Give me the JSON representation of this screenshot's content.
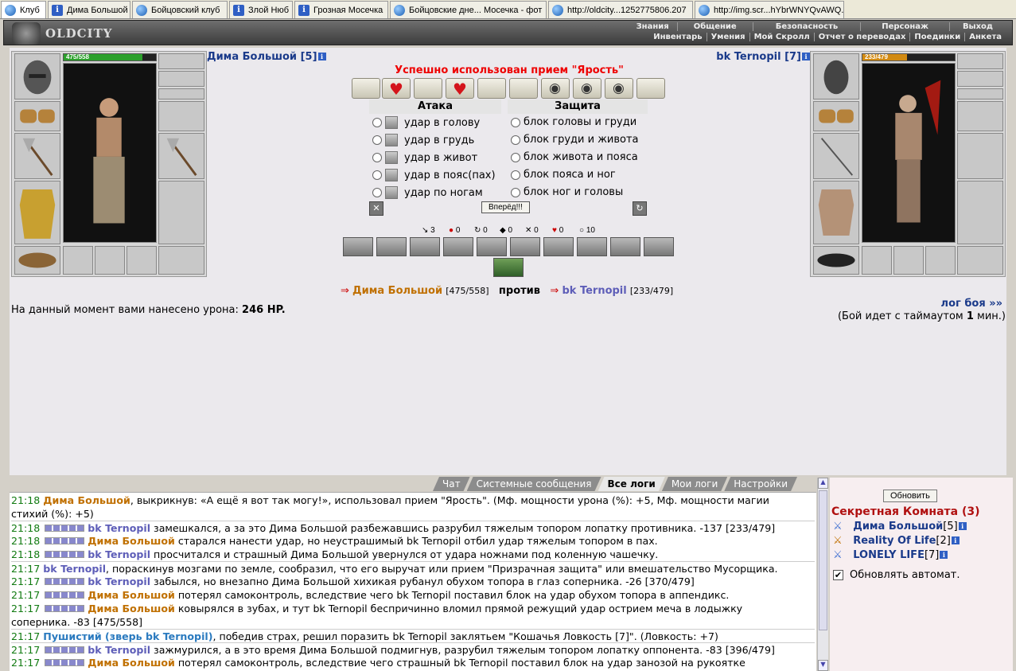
{
  "tabs": [
    {
      "label": "Клуб",
      "icon": "globe-icon",
      "active": true
    },
    {
      "label": "Дима Большой",
      "icon": "info-icon"
    },
    {
      "label": "Бойцовский клуб",
      "icon": "globe-icon"
    },
    {
      "label": "Злой Нюб",
      "icon": "info-icon"
    },
    {
      "label": "Грозная Мосечка",
      "icon": "info-icon"
    },
    {
      "label": "Бойцовские дне... Мосечка - фот",
      "icon": "globe-icon"
    },
    {
      "label": "http://oldcity...1252775806.207",
      "icon": "globe-icon"
    },
    {
      "label": "http://img.scr...hYbrWNYQvAWQ.j",
      "icon": "globe-icon"
    }
  ],
  "menu": {
    "logo": "OLDCITY",
    "row1": [
      "Знания",
      "Общение",
      "Безопасность",
      "Персонаж",
      "Выход"
    ],
    "row2": [
      "Инвентарь",
      "Умения",
      "Мой Скролл",
      "Отчет о переводах",
      "Поединки",
      "Анкета"
    ]
  },
  "battle": {
    "player": {
      "name": "Дима Большой",
      "level": "[5]",
      "hp_text": "475/558",
      "hp_frac": 0.851
    },
    "enemy": {
      "name": "bk Ternopil",
      "level": "[7]",
      "hp_text": "233/479",
      "hp_frac": 0.486
    },
    "message": "Успешно использован прием \"Ярость\"",
    "attack_header": "Атака",
    "defense_header": "Защита",
    "attacks": [
      "удар в голову",
      "удар в грудь",
      "удар в живот",
      "удар в пояс(пах)",
      "удар по ногам"
    ],
    "defenses": [
      "блок головы и груди",
      "блок груди и живота",
      "блок живота и пояса",
      "блок пояса и ног",
      "блок ног и головы"
    ],
    "go_button": "Вперёд!!!",
    "counters": [
      "3",
      "0",
      "0",
      "0",
      "0",
      "0",
      "10"
    ],
    "vs_left_name": "Дима Большой",
    "vs_left_hp": "[475/558]",
    "vs_word": "против",
    "vs_right_name": "bk Ternopil",
    "vs_right_hp": "[233/479]",
    "damage_prefix": "На данный момент вами нанесено урона:",
    "damage_value": "246 HP.",
    "log_link": "лог боя »»",
    "timeout_pre": "(Бой идет с таймаутом",
    "timeout_val": "1",
    "timeout_post": "мин.)"
  },
  "log_tabs": [
    "Чат",
    "Системные сообщения",
    "Все логи",
    "Мои логи",
    "Настройки"
  ],
  "log_lines": [
    [
      "21:18 ",
      "Дима Большой",
      ", выкрикнув: «А ещё я вот так могу!», использовал прием \"Ярость\". (Мф. мощности урона (%): +5, Мф. мощности магии"
    ],
    [
      "",
      "",
      "стихий (%): +5)"
    ],
    [
      "21:18 ",
      "bk Ternopil",
      " замешкался, а за это Дима Большой разбежавшись разрубил тяжелым топором лопатку противника. -137 [233/479]"
    ],
    [
      "21:18 ",
      "Дима Большой",
      " старался нанести удар, но неустрашимый bk Ternopil отбил удар тяжелым топором в пах."
    ],
    [
      "21:18 ",
      "bk Ternopil",
      " просчитался и страшный Дима Большой увернулся от удара ножнами под коленную чашечку."
    ],
    [
      "21:17 ",
      "bk Ternopil",
      ", пораскинув мозгами по земле, сообразил, что его выручат или прием \"Призрачная защита\" или вмешательство Мусорщика."
    ],
    [
      "21:17 ",
      "bk Ternopil",
      " забылся, но внезапно Дима Большой хихикая рубанул обухом топора в глаз соперника. -26 [370/479]"
    ],
    [
      "21:17 ",
      "Дима Большой",
      " потерял самоконтроль, вследствие чего bk Ternopil поставил блок на удар обухом топора в аппендикс."
    ],
    [
      "21:17 ",
      "Дима Большой",
      " ковырялся в зубах, и тут bk Ternopil беспричинно вломил прямой режущий удар острием меча в лодыжку"
    ],
    [
      "",
      "",
      "соперника. -83 [475/558]"
    ],
    [
      "21:17 ",
      "Пушистий (зверь bk Ternopil)",
      ", победив страх, решил поразить bk Ternopil заклятьем \"Кошачья Ловкость [7]\". (Ловкость: +7)"
    ],
    [
      "21:17 ",
      "bk Ternopil",
      " зажмурился, а в это время Дима Большой подмигнув, разрубил тяжелым топором лопатку оппонента. -83 [396/479]"
    ],
    [
      "21:17 ",
      "Дима Большой",
      " потерял самоконтроль, вследствие чего страшный bk Ternopil поставил блок на удар занозой на рукоятке"
    ]
  ],
  "room": {
    "refresh": "Обновить",
    "title": "Секретная Комната (3)",
    "members": [
      {
        "name": "Дима Большой",
        "level": "[5]"
      },
      {
        "name": "Reality Of Life",
        "level": "[2]"
      },
      {
        "name": "LONELY LIFE",
        "level": "[7]"
      }
    ],
    "auto": "Обновлять автомат."
  }
}
